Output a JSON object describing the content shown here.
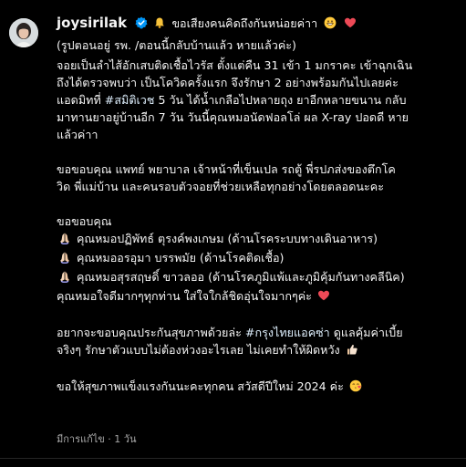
{
  "post": {
    "username": "joysirilak",
    "caption_line1": "ขอเสียงคนคิดถึงกันหน่อยค่าา",
    "caption_line2": "(รูปตอนอยู่ รพ. /ตอนนี้กลับบ้านแล้ว หายแล้วค่ะ)",
    "paragraphs": [
      {
        "lines": [
          [
            {
              "t": "จอยเป็นลำไส้อักเสบติดเชื้อไวรัส ตั้งแต่คืน 31 เข้า 1 มกราคะ เข้าฉุกเฉิน"
            }
          ],
          [
            {
              "t": "ถึงได้ตรวจพบว่า เป็นโควิดครั้งแรก จึงรักษา 2 อย่างพร้อมกันไปเลยค่ะ"
            }
          ],
          [
            {
              "t": "แอดมิทที่ "
            },
            {
              "t": "#สมิติเวช",
              "tag": true
            },
            {
              "t": " 5 วัน ได้น้ำเกลือไปหลายถุง ยาอีกหลายขนาน กลับ"
            }
          ],
          [
            {
              "t": "มาทานยาอยู่บ้านอีก 7 วัน วันนี้คุณหมอนัดฟอลโล่ ผล X-ray ปอดดี หาย"
            }
          ],
          [
            {
              "t": "แล้วค่าา"
            }
          ]
        ]
      },
      {
        "lines": [
          [
            {
              "t": "ขอขอบคุณ แพทย์ พยาบาล เจ้าหน้าที่เข็นเปล รถตู้ พี่รปภส่งของตึกโค"
            }
          ],
          [
            {
              "t": "วิด พี่แม่บ้าน และคนรอบตัวจอยที่ช่วยเหลือทุกอย่างโดยตลอดนะคะ"
            }
          ]
        ]
      },
      {
        "lines": [
          [
            {
              "t": "ขอขอบคุณ"
            }
          ],
          [
            {
              "emoji": "pray"
            },
            {
              "t": " คุณหมอปฏิพัทธ์ ตุรงค์พงเกษม (ด้านโรคระบบทางเดินอาหาร)"
            }
          ],
          [
            {
              "emoji": "pray"
            },
            {
              "t": " คุณหมออรอุมา บรรพมัย (ด้านโรคติดเชื้อ)"
            }
          ],
          [
            {
              "emoji": "pray"
            },
            {
              "t": " คุณหมอสุรสฤษดิ์ ขาวลออ (ด้านโรคภูมิแพ้และภูมิคุ้มกันทางคลีนิค)"
            }
          ],
          [
            {
              "t": "คุณหมอใจดีมากๆทุกท่าน ใส่ใจใกล้ชิดอุ่นใจมากๆค่ะ "
            },
            {
              "emoji": "heart"
            }
          ]
        ]
      },
      {
        "lines": [
          [
            {
              "t": "อยากจะขอบคุณประกันสุขภาพด้วยล่ะ "
            },
            {
              "t": "#กรุงไทยแอคซ่า",
              "tag": true
            },
            {
              "t": " ดูแลคุ้มค่าเบี้ย"
            }
          ],
          [
            {
              "t": "จริงๆ รักษาตัวแบบไม่ต้องห่วงอะไรเลย ไม่เคยทำให้ผิดหวัง "
            },
            {
              "emoji": "thumb"
            }
          ]
        ]
      },
      {
        "lines": [
          [
            {
              "t": "ขอให้สุขภาพแข็งแรงกันนะคะทุกคน สวัสดีปีใหม่ 2024 ค่ะ "
            },
            {
              "emoji": "kiss"
            }
          ]
        ]
      }
    ],
    "meta": "มีการแก้ไข · 1 วัน"
  },
  "colors": {
    "background": "#000000",
    "text": "#f5f5f5",
    "meta": "#a8a8a8",
    "verified": "#0095f6",
    "hashtag": "#e0f1ff",
    "heart": "#ed4956"
  }
}
